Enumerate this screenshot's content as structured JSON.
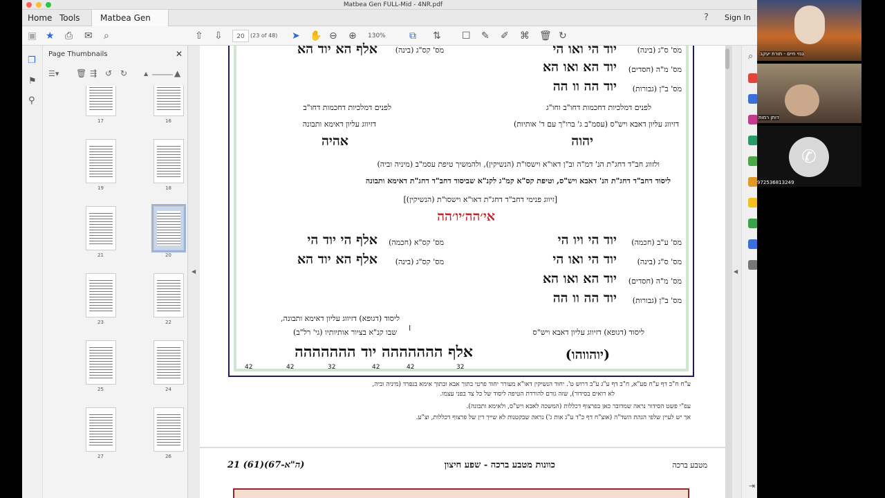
{
  "window": {
    "title": "Matbea Gen FULL-Mid - 4NR.pdf"
  },
  "tabs": {
    "home": "Home",
    "tools": "Tools",
    "doc": "Matbea Gen FULL...",
    "signin": "Sign In"
  },
  "toolbar": {
    "page_input": "20",
    "page_count": "(23 of 48)",
    "zoom": "130%"
  },
  "thumbs": {
    "title": "Page Thumbnails",
    "labels": [
      "17",
      "16",
      "19",
      "18",
      "21",
      "20",
      "23",
      "22",
      "25",
      "24",
      "27",
      "26"
    ]
  },
  "doc": {
    "r1a": "יוד הי ואו הי",
    "r1al": "מס' ס\"ג (בינה)",
    "r1b": "אלף הא יוד הא",
    "r1bl": "מס' קס\"ג (בינה)",
    "r2a": "יוד הא ואו הא",
    "r2al": "מס' מ\"ה (חסדים)",
    "r3a": "יוד הה וו הה",
    "r3al": "מס' ב\"ן (גבורות)",
    "p1r": "לפנים דמלכיות דחכמות דחו\"ב וחו\"ג",
    "p1l": "לפנים דמלכיות דחכמות דחו\"ב",
    "p2r": "דזיווג עליון דאבא ויש\"ס (עסמ\"ב ג' ברו\"ך עם ד' אותיות)",
    "p2l": "דזיווג עליון דאימא ותבונה",
    "n1": "יהוה",
    "n2": "אהיה",
    "line1": "ולזווג חב\"ד דחג\"ת הנ' דמ\"ה וב\"ן דאו\"א וישסו\"ת (הנשיקין), ולהמשיך טיפת עסמ\"ב (מיניה וביה)",
    "line2": "ליסוד דחב\"ד דחג\"ת הנ' דאבא ויש\"ס, וטיפת קס\"א קמ\"ג לקנ\"א שביסוד דחב\"ד דחג\"ת דאימא ותבונה",
    "bracket": "[זיווג פנימי דחב\"ד דחג\"ת דאו\"א וישסו\"ת (הנשיקין)]",
    "combo": "אי׳הה׳יו׳הה",
    "s1a": "יוד הי ויו הי",
    "s1al": "מס' ע\"ב (חכמה)",
    "s1b": "אלף הי יוד הי",
    "s1bl": "מס' קס\"א (חכמה)",
    "s2a": "יוד הי ואו הי",
    "s2al": "מס' ס\"ג (בינה)",
    "s2b": "אלף הא יוד הא",
    "s2bl": "מס' קס\"ג (בינה)",
    "s3a": "יוד הא ואו הא",
    "s3al": "מס' מ\"ה (חסדים)",
    "s4a": "יוד הה וו הה",
    "s4al": "מס' ב\"ן (גבורות)",
    "y1r": "ליסוד (דגופא) דזיווג עליון דאבא ויש\"ס",
    "y1l": "ליסוד (דגופא) דזיווג עליון דאימא ותבונה,",
    "y2l": "שבו קנ\"א בציור אותיותיו (גי' רל\"ב)",
    "bot_r": "(יוהווהו)",
    "bot_l": "אלף ההההההה יוד ההההההה",
    "nums": [
      "42",
      "42",
      "32",
      "42",
      "42",
      "32"
    ],
    "f1": "ע\"ח ח\"ב דף ע\"ח סע\"א, ח\"ב דף ע\"ג ע\"ב דרוש ט'. יחוד הנשיקין דאו\"א מעורר יחוד פרטי בתוך אבא ובתוך אימא בנפרד (מיניה וביה,",
    "f1b": "לא רואים בסידור), שזה גורם להורדת הטיפה ליסוד של כל צד בפני עצמו.",
    "f2": "עפ\"י פשט הסידור נראה שמדובר כאן בפרצוף דכללות (המשכה לאבא ויש\"ס, ולאימא ותבונה).",
    "f3": "אך יש לעיין שלפי הגהת השד\"ה (אוצ\"ח דף כ\"ד ע\"ג אות ג') נראה שבקטנות לא שייך דין של פרצוף דכללות, וצ\"ע.",
    "h2r": "מטבע ברכה",
    "h2m": "כוונות מטבע ברכה - שפע חיצון",
    "h2l": "21 (61)(67-ה\"א)"
  },
  "video": {
    "name1": "גנזי חיים - תורת יעקב",
    "name2": "דותן רמות",
    "phone": "972536813249"
  }
}
